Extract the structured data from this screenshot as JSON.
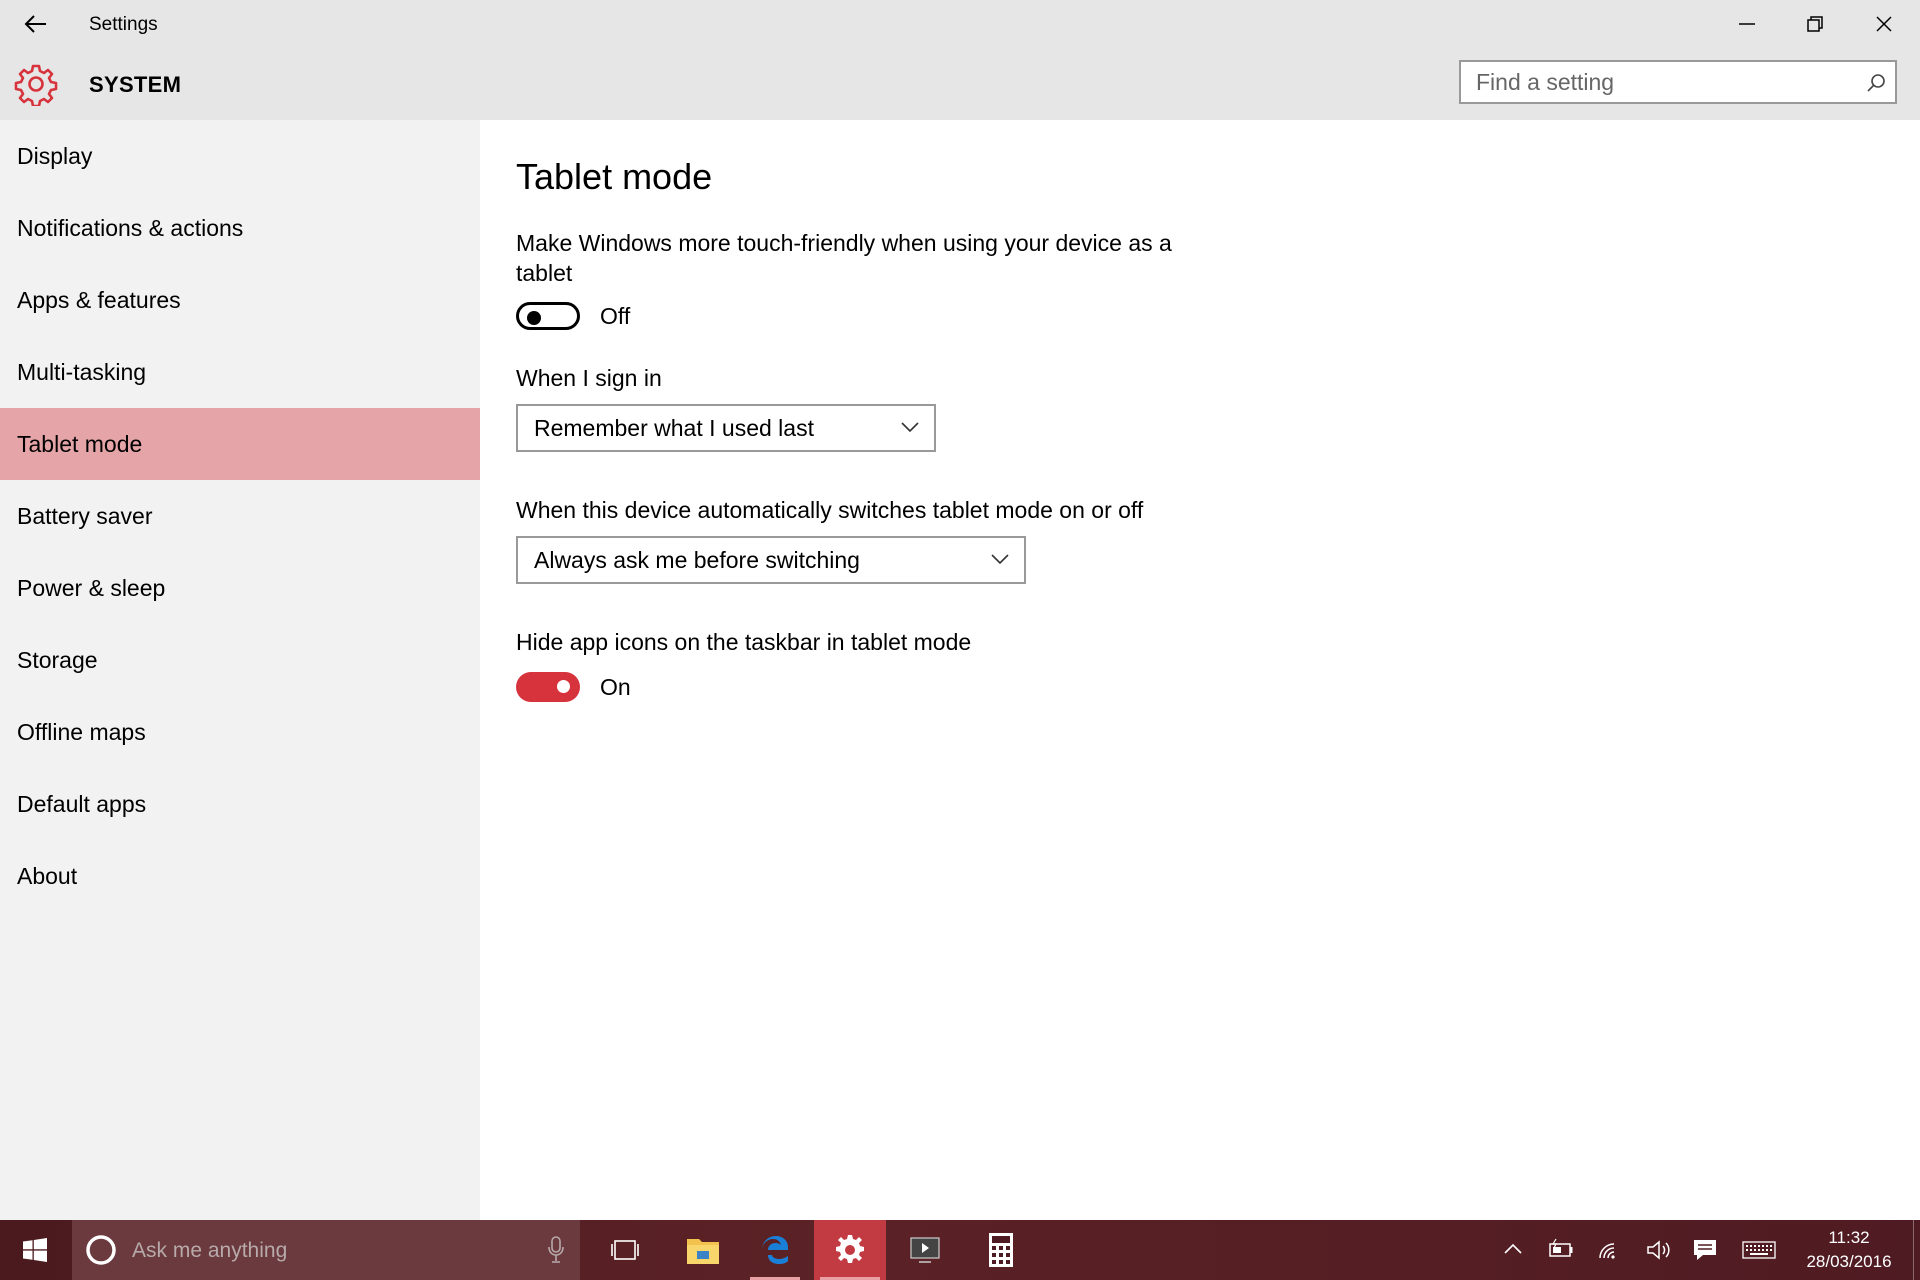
{
  "window": {
    "title": "Settings",
    "section_title": "SYSTEM",
    "search_placeholder": "Find a setting"
  },
  "sidebar": {
    "items": [
      {
        "label": "Display",
        "selected": false
      },
      {
        "label": "Notifications & actions",
        "selected": false
      },
      {
        "label": "Apps & features",
        "selected": false
      },
      {
        "label": "Multi-tasking",
        "selected": false
      },
      {
        "label": "Tablet mode",
        "selected": true
      },
      {
        "label": "Battery saver",
        "selected": false
      },
      {
        "label": "Power & sleep",
        "selected": false
      },
      {
        "label": "Storage",
        "selected": false
      },
      {
        "label": "Offline maps",
        "selected": false
      },
      {
        "label": "Default apps",
        "selected": false
      },
      {
        "label": "About",
        "selected": false
      }
    ]
  },
  "content": {
    "title": "Tablet mode",
    "touch_desc_line1": "Make Windows more touch-friendly when using your device as a",
    "touch_desc_line2": "tablet",
    "touch_toggle": {
      "state": "Off",
      "on": false
    },
    "sign_in_label": "When I sign in",
    "sign_in_value": "Remember what I used last",
    "switch_label": "When this device automatically switches tablet mode on or off",
    "switch_value": "Always ask me before switching",
    "hide_icons_label": "Hide app icons on the taskbar in tablet mode",
    "hide_icons_toggle": {
      "state": "On",
      "on": true
    }
  },
  "taskbar": {
    "search_placeholder": "Ask me anything",
    "clock_time": "11:32",
    "clock_date": "28/03/2016"
  },
  "colors": {
    "accent": "#d7333c",
    "selected_nav": "#e5a5a8",
    "header_bg": "#e6e6e6",
    "sidebar_bg": "#f2f2f2"
  }
}
